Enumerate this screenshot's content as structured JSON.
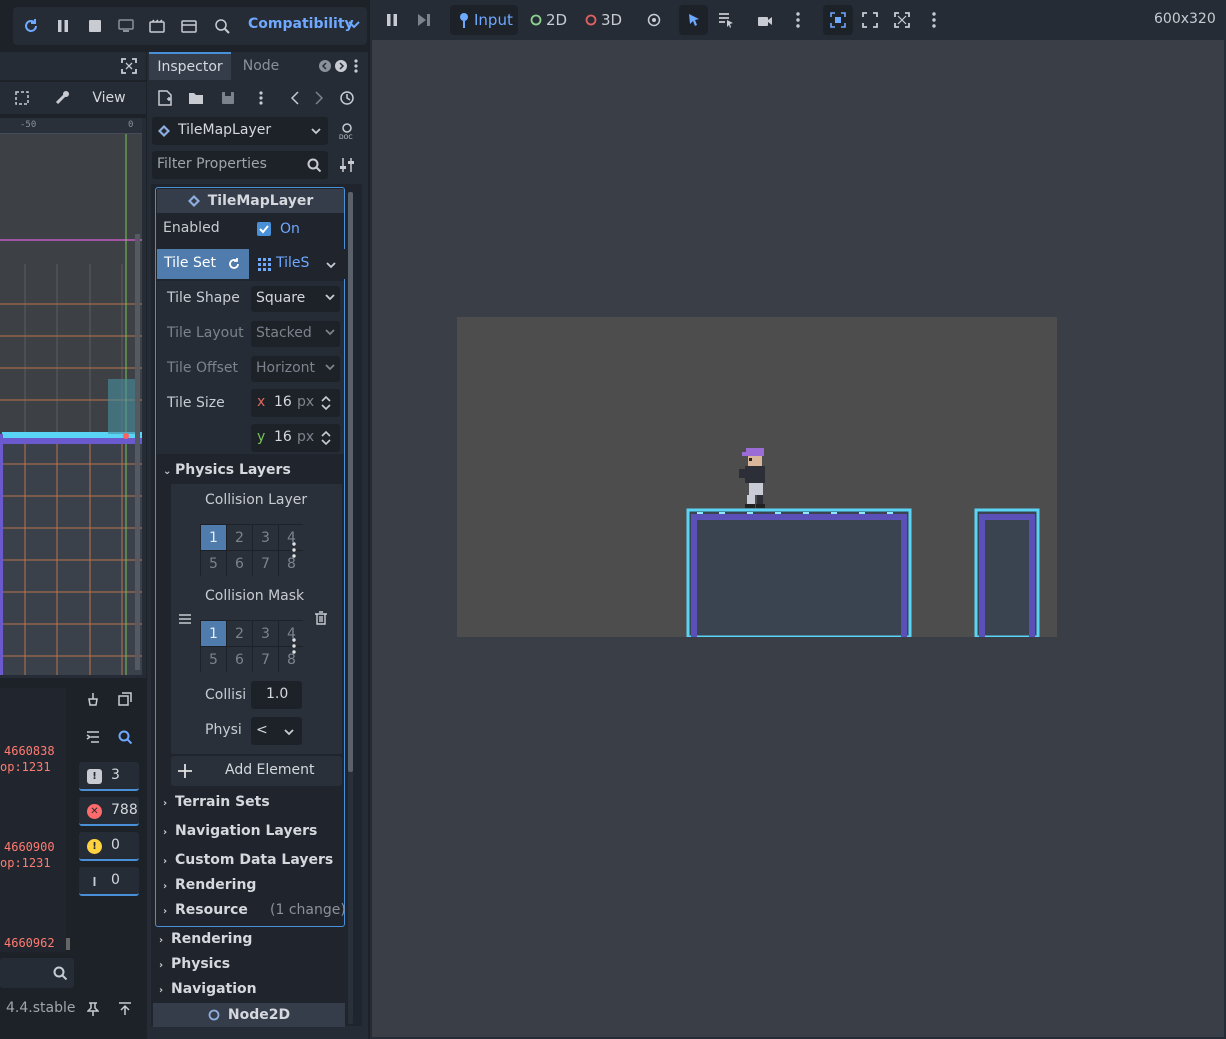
{
  "toolbar": {
    "renderer_label": "Compatibility"
  },
  "editor": {
    "view_label": "View",
    "ruler_ticks": [
      "-50",
      "0"
    ]
  },
  "output": {
    "lines": [
      "4660838",
      "op:1231",
      "",
      "",
      "",
      "",
      "4660900",
      "op:1231",
      "",
      "",
      "",
      "",
      "4660962"
    ],
    "counts": {
      "messages": "3",
      "errors": "788",
      "warnings": "0",
      "debug": "0"
    },
    "version": "4.4.stable"
  },
  "inspector": {
    "tabs": {
      "inspector": "Inspector",
      "node": "Node"
    },
    "node_type": "TileMapLayer",
    "filter_placeholder": "Filter Properties",
    "section_title": "TileMapLayer",
    "enabled": {
      "label": "Enabled",
      "value": "On"
    },
    "tile_set": {
      "label": "Tile Set",
      "value": "TileS"
    },
    "tile_shape": {
      "label": "Tile Shape",
      "value": "Square"
    },
    "tile_layout": {
      "label": "Tile Layout",
      "value": "Stacked"
    },
    "tile_offset": {
      "label": "Tile Offset",
      "value": "Horizont"
    },
    "tile_size": {
      "label": "Tile Size",
      "x_label": "x",
      "x": "16",
      "y_label": "y",
      "y": "16",
      "unit": "px"
    },
    "physics_layers": {
      "title": "Physics Layers",
      "collision_layer": "Collision Layer",
      "collision_mask": "Collision Mask",
      "layer_numbers": [
        "1",
        "2",
        "3",
        "4",
        "5",
        "6",
        "7",
        "8"
      ],
      "collision_priority_label": "Collisi",
      "collision_priority": "1.0",
      "physics_material_label": "Physi",
      "physics_material_value": "<",
      "add_element": "Add Element"
    },
    "groups": [
      "Terrain Sets",
      "Navigation Layers",
      "Custom Data Layers",
      "Rendering"
    ],
    "resource": {
      "label": "Resource",
      "note": "(1 change)"
    },
    "outer_groups": [
      "Rendering",
      "Physics",
      "Navigation"
    ],
    "node2d_section": "Node2D"
  },
  "viewport": {
    "buttons": {
      "input": "Input",
      "two_d": "2D",
      "three_d": "3D"
    },
    "resolution": "600x320"
  },
  "colors": {
    "accent": "#4a90d9",
    "error": "#ff7b72",
    "tile_outline": "#5ad4f5",
    "tile_fill": "#3a4350",
    "game_bg": "#4d4d4d"
  }
}
